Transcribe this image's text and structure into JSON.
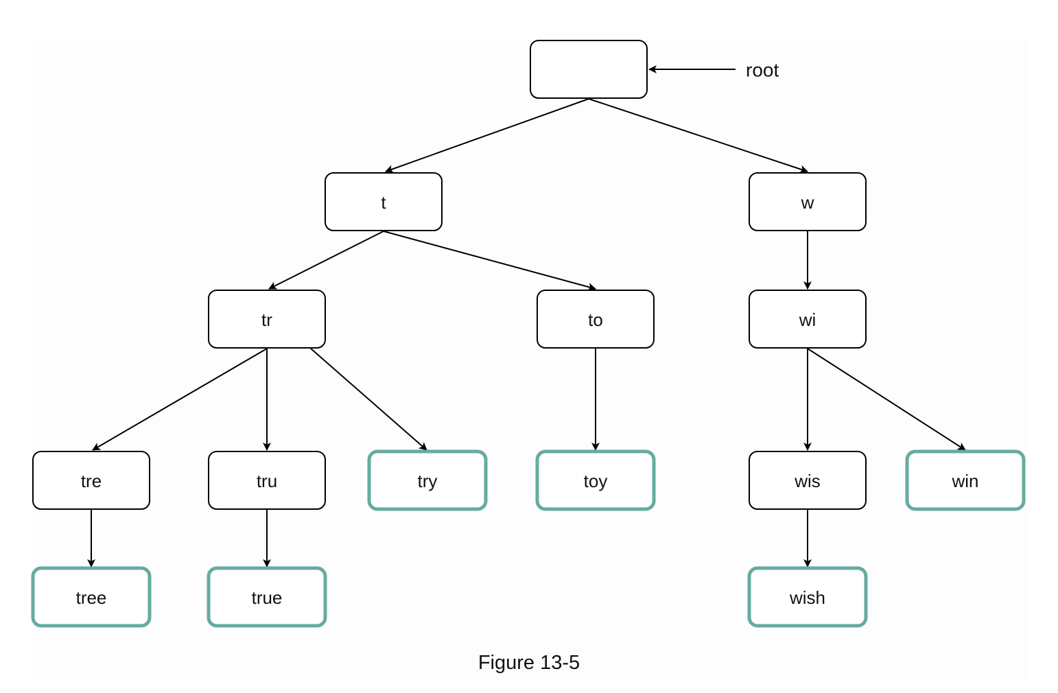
{
  "figure": {
    "caption": "Figure 13-5",
    "root_label": "root",
    "colors": {
      "regular_border": "#000000",
      "terminal_border": "#67ab9f",
      "edge": "#000000"
    }
  },
  "nodes": [
    {
      "id": "root",
      "label": "",
      "terminal": false
    },
    {
      "id": "t",
      "label": "t",
      "terminal": false
    },
    {
      "id": "w",
      "label": "w",
      "terminal": false
    },
    {
      "id": "tr",
      "label": "tr",
      "terminal": false
    },
    {
      "id": "to",
      "label": "to",
      "terminal": false
    },
    {
      "id": "wi",
      "label": "wi",
      "terminal": false
    },
    {
      "id": "tre",
      "label": "tre",
      "terminal": false
    },
    {
      "id": "tru",
      "label": "tru",
      "terminal": false
    },
    {
      "id": "try",
      "label": "try",
      "terminal": true
    },
    {
      "id": "toy",
      "label": "toy",
      "terminal": true
    },
    {
      "id": "wis",
      "label": "wis",
      "terminal": false
    },
    {
      "id": "win",
      "label": "win",
      "terminal": true
    },
    {
      "id": "tree",
      "label": "tree",
      "terminal": true
    },
    {
      "id": "true",
      "label": "true",
      "terminal": true
    },
    {
      "id": "wish",
      "label": "wish",
      "terminal": true
    }
  ],
  "edges": [
    {
      "from": "root",
      "to": "t"
    },
    {
      "from": "root",
      "to": "w"
    },
    {
      "from": "t",
      "to": "tr"
    },
    {
      "from": "t",
      "to": "to"
    },
    {
      "from": "w",
      "to": "wi"
    },
    {
      "from": "tr",
      "to": "tre"
    },
    {
      "from": "tr",
      "to": "tru"
    },
    {
      "from": "tr",
      "to": "try"
    },
    {
      "from": "to",
      "to": "toy"
    },
    {
      "from": "wi",
      "to": "wis"
    },
    {
      "from": "wi",
      "to": "win"
    },
    {
      "from": "tre",
      "to": "tree"
    },
    {
      "from": "tru",
      "to": "true"
    },
    {
      "from": "wis",
      "to": "wish"
    }
  ]
}
